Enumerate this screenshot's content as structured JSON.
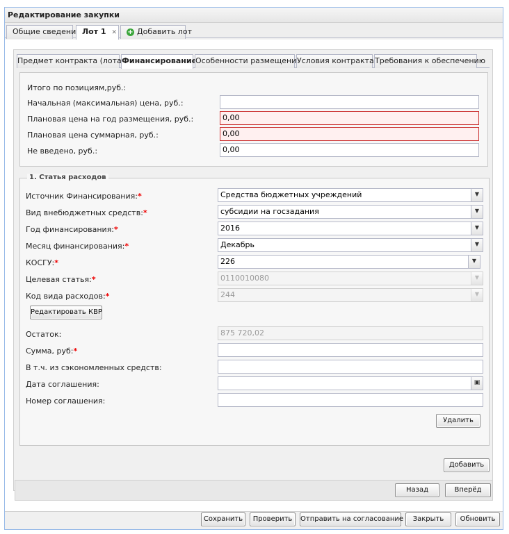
{
  "window": {
    "title": "Редактирование закупки"
  },
  "top_tabs": [
    {
      "label": "Общие сведения"
    },
    {
      "label": "Лот 1"
    },
    {
      "label": "Добавить лот"
    }
  ],
  "sub_tabs": [
    {
      "label": "Предмет контракта (лота)"
    },
    {
      "label": "Финансирование"
    },
    {
      "label": "Особенности размещения"
    },
    {
      "label": "Условия контракта"
    },
    {
      "label": "Требования к обеспечению"
    }
  ],
  "totals": {
    "header": "Итого по позициям,руб.:",
    "rows": [
      {
        "label": "Начальная (максимальная) цена, руб.:",
        "value": ""
      },
      {
        "label": "Плановая цена на год размещения, руб.:",
        "value": "0,00"
      },
      {
        "label": "Плановая цена суммарная, руб.:",
        "value": "0,00"
      },
      {
        "label": "Не введено, руб.:",
        "value": "0,00"
      }
    ]
  },
  "expense": {
    "legend": "1. Статья расходов",
    "fields": [
      {
        "label": "Источник Финансирования:",
        "value": "Средства бюджетных учреждений"
      },
      {
        "label": "Вид внебюджетных средств:",
        "value": "субсидии на госзадания"
      },
      {
        "label": "Год финансирования:",
        "value": "2016"
      },
      {
        "label": "Месяц финансирования:",
        "value": "Декабрь"
      },
      {
        "label": "КОСГУ:",
        "value": "226"
      },
      {
        "label": "Целевая статья:",
        "value": "0110010080"
      },
      {
        "label": "Код вида расходов:",
        "value": "244"
      }
    ],
    "edit_kvr_label": "Редактировать КВР",
    "remaining": {
      "label": "Остаток:",
      "value": "875 720,02"
    },
    "sum": {
      "label": "Сумма, руб:",
      "value": ""
    },
    "saved": {
      "label": "В т.ч. из сэкономленных средств:",
      "value": ""
    },
    "agreement_date": {
      "label": "Дата соглашения:",
      "value": ""
    },
    "agreement_number": {
      "label": "Номер соглашения:",
      "value": ""
    },
    "delete_label": "Удалить"
  },
  "add_label": "Добавить",
  "nav": {
    "back_label": "Назад",
    "forward_label": "Вперёд"
  },
  "footer": {
    "save": "Сохранить",
    "check": "Проверить",
    "send": "Отправить на согласование",
    "close": "Закрыть",
    "refresh": "Обновить"
  },
  "colors": {
    "required": "#ee0000",
    "error_border": "#cc3333",
    "error_bg": "#fff0f0"
  },
  "icons": [
    "close-icon",
    "add-icon",
    "chevron-down-icon",
    "calendar-icon"
  ]
}
